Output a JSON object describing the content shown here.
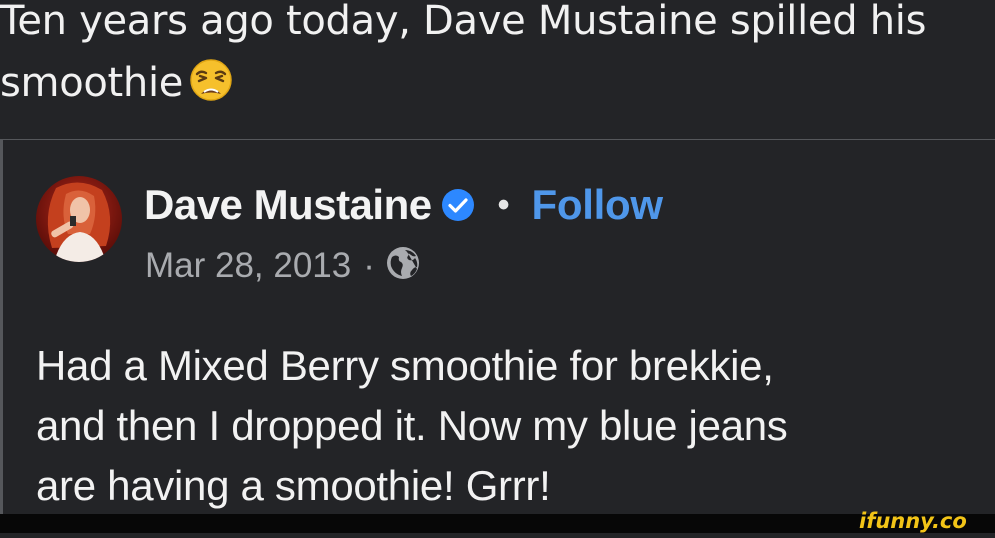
{
  "headline": {
    "lines": [
      "Ten years ago today, Dave Mustaine spilled his",
      "smoothie"
    ],
    "emoji": "weary-face-emoji"
  },
  "post": {
    "author_name": "Dave Mustaine",
    "verified_icon": "verified-checkmark-icon",
    "separator": "•",
    "follow_label": "Follow",
    "date": "Mar 28, 2013",
    "meta_separator": "·",
    "privacy_icon": "globe-icon",
    "body_lines": [
      "Had a Mixed Berry smoothie for brekkie,",
      "and then I dropped it. Now my blue jeans",
      "are having a smoothie! Grrr!"
    ]
  },
  "watermark": {
    "text": "ifunny.co"
  },
  "colors": {
    "background": "#232427",
    "text": "#f2f2f2",
    "muted": "#a9abaf",
    "link": "#4f97ea",
    "verified": "#2d88ff",
    "divider": "#55575b",
    "watermark": "#f2c417"
  }
}
